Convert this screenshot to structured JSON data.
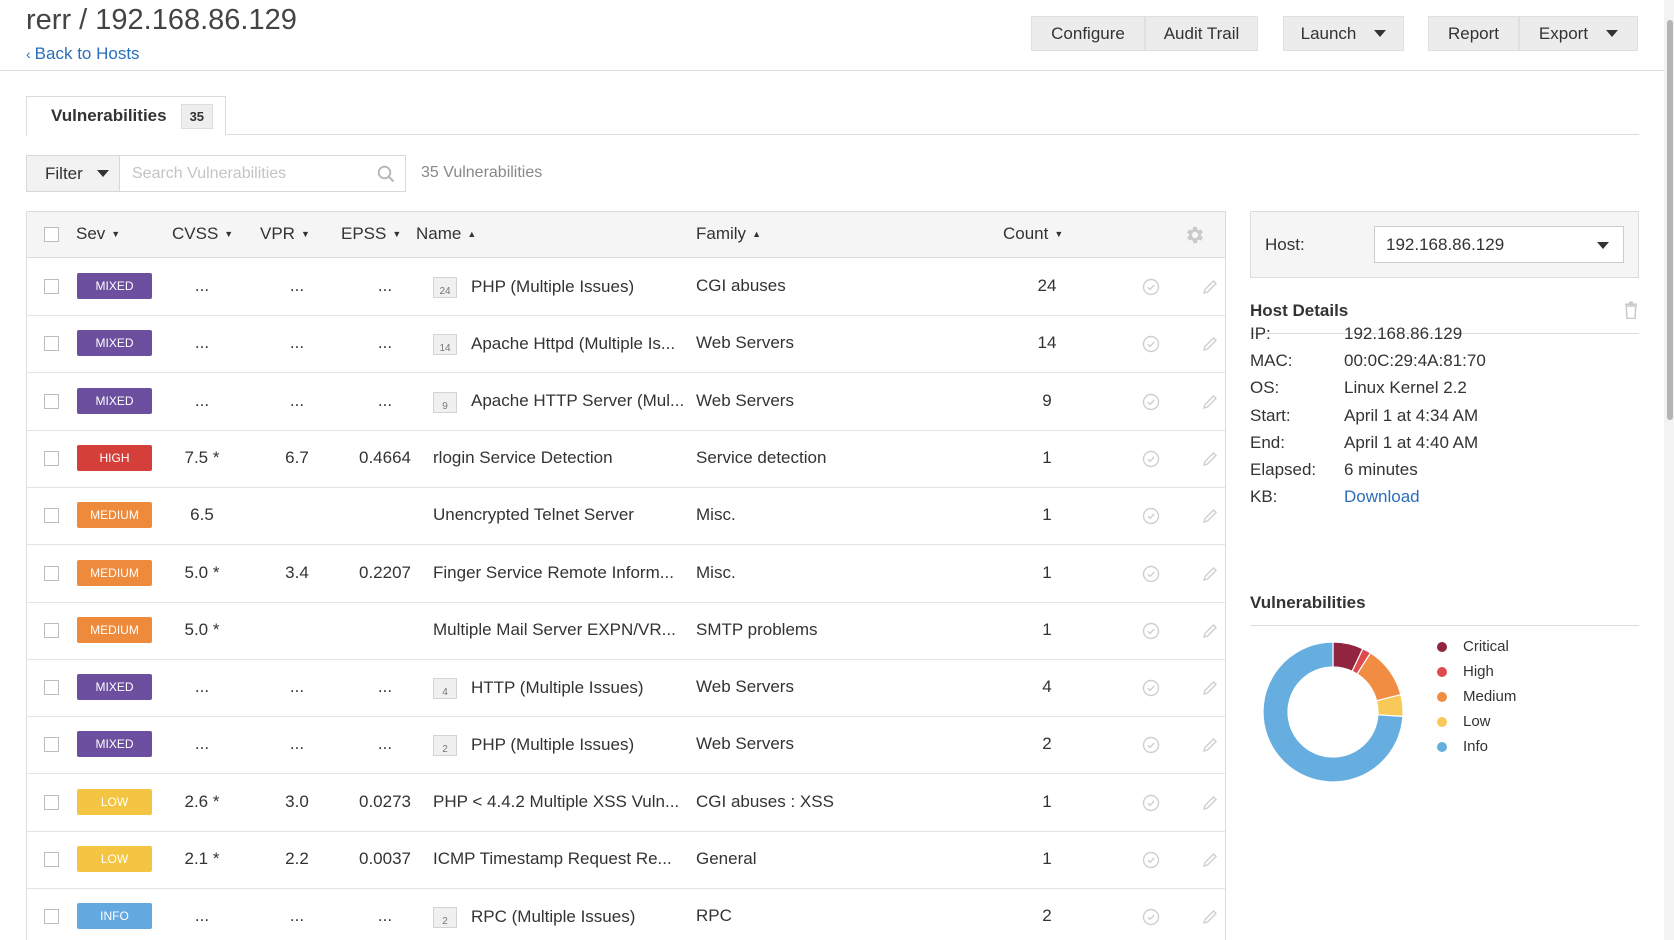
{
  "header": {
    "title": "rerr / 192.168.86.129",
    "back_link": "Back to Hosts",
    "buttons": {
      "configure": "Configure",
      "audit_trail": "Audit Trail",
      "launch": "Launch",
      "report": "Report",
      "export": "Export"
    }
  },
  "tabs": [
    {
      "label": "Vulnerabilities",
      "count": "35"
    }
  ],
  "filter": {
    "button_label": "Filter",
    "search_placeholder": "Search Vulnerabilities",
    "result_count": "35 Vulnerabilities"
  },
  "table": {
    "columns": {
      "sev": "Sev",
      "cvss": "CVSS",
      "vpr": "VPR",
      "epss": "EPSS",
      "name": "Name",
      "family": "Family",
      "count": "Count"
    },
    "rows": [
      {
        "sev": "MIXED",
        "sev_color": "#6c4f9e",
        "cvss": "...",
        "vpr": "...",
        "epss": "...",
        "group": "24",
        "name": "PHP (Multiple Issues)",
        "family": "CGI abuses",
        "count": "24"
      },
      {
        "sev": "MIXED",
        "sev_color": "#6c4f9e",
        "cvss": "...",
        "vpr": "...",
        "epss": "...",
        "group": "14",
        "name": "Apache Httpd (Multiple Is...",
        "family": "Web Servers",
        "count": "14"
      },
      {
        "sev": "MIXED",
        "sev_color": "#6c4f9e",
        "cvss": "...",
        "vpr": "...",
        "epss": "...",
        "group": "9",
        "name": "Apache HTTP Server (Mul...",
        "family": "Web Servers",
        "count": "9"
      },
      {
        "sev": "HIGH",
        "sev_color": "#d43f3a",
        "cvss": "7.5 *",
        "vpr": "6.7",
        "epss": "0.4664",
        "group": "",
        "name": "rlogin Service Detection",
        "family": "Service detection",
        "count": "1"
      },
      {
        "sev": "MEDIUM",
        "sev_color": "#ee8a3c",
        "cvss": "6.5",
        "vpr": "",
        "epss": "",
        "group": "",
        "name": "Unencrypted Telnet Server",
        "family": "Misc.",
        "count": "1"
      },
      {
        "sev": "MEDIUM",
        "sev_color": "#ee8a3c",
        "cvss": "5.0 *",
        "vpr": "3.4",
        "epss": "0.2207",
        "group": "",
        "name": "Finger Service Remote Inform...",
        "family": "Misc.",
        "count": "1"
      },
      {
        "sev": "MEDIUM",
        "sev_color": "#ee8a3c",
        "cvss": "5.0 *",
        "vpr": "",
        "epss": "",
        "group": "",
        "name": "Multiple Mail Server EXPN/VR...",
        "family": "SMTP problems",
        "count": "1"
      },
      {
        "sev": "MIXED",
        "sev_color": "#6c4f9e",
        "cvss": "...",
        "vpr": "...",
        "epss": "...",
        "group": "4",
        "name": "HTTP (Multiple Issues)",
        "family": "Web Servers",
        "count": "4"
      },
      {
        "sev": "MIXED",
        "sev_color": "#6c4f9e",
        "cvss": "...",
        "vpr": "...",
        "epss": "...",
        "group": "2",
        "name": "PHP (Multiple Issues)",
        "family": "Web Servers",
        "count": "2"
      },
      {
        "sev": "LOW",
        "sev_color": "#f4c542",
        "cvss": "2.6 *",
        "vpr": "3.0",
        "epss": "0.0273",
        "group": "",
        "name": "PHP < 4.4.2 Multiple XSS Vuln...",
        "family": "CGI abuses : XSS",
        "count": "1"
      },
      {
        "sev": "LOW",
        "sev_color": "#f4c542",
        "cvss": "2.1 *",
        "vpr": "2.2",
        "epss": "0.0037",
        "group": "",
        "name": "ICMP Timestamp Request Re...",
        "family": "General",
        "count": "1"
      },
      {
        "sev": "INFO",
        "sev_color": "#64a8e0",
        "cvss": "...",
        "vpr": "...",
        "epss": "...",
        "group": "2",
        "name": "RPC (Multiple Issues)",
        "family": "RPC",
        "count": "2"
      }
    ]
  },
  "side": {
    "host_label": "Host:",
    "host_value": "192.168.86.129",
    "details_title": "Host Details",
    "details": [
      {
        "key": "IP:",
        "value": "192.168.86.129"
      },
      {
        "key": "MAC:",
        "value": "00:0C:29:4A:81:70"
      },
      {
        "key": "OS:",
        "value": "Linux Kernel 2.2"
      },
      {
        "key": "Start:",
        "value": "April 1 at 4:34 AM"
      },
      {
        "key": "End:",
        "value": "April 1 at 4:40 AM"
      },
      {
        "key": "Elapsed:",
        "value": "6 minutes"
      },
      {
        "key": "KB:",
        "value": "Download"
      }
    ],
    "vuln_title": "Vulnerabilities",
    "chart_data": {
      "type": "pie",
      "categories": [
        "Critical",
        "High",
        "Medium",
        "Low",
        "Info"
      ],
      "values": [
        7,
        2,
        12,
        5,
        74
      ],
      "colors": [
        "#91243e",
        "#dd4b50",
        "#f18c43",
        "#f8c858",
        "#67aee0"
      ],
      "legend": "right"
    }
  }
}
